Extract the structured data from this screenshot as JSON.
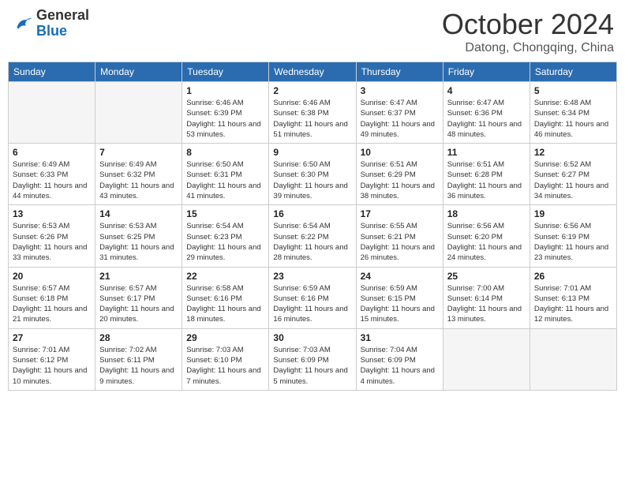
{
  "header": {
    "logo_general": "General",
    "logo_blue": "Blue",
    "month_title": "October 2024",
    "location": "Datong, Chongqing, China"
  },
  "days_of_week": [
    "Sunday",
    "Monday",
    "Tuesday",
    "Wednesday",
    "Thursday",
    "Friday",
    "Saturday"
  ],
  "weeks": [
    [
      {
        "day": "",
        "empty": true
      },
      {
        "day": "",
        "empty": true
      },
      {
        "day": "1",
        "sunrise": "Sunrise: 6:46 AM",
        "sunset": "Sunset: 6:39 PM",
        "daylight": "Daylight: 11 hours and 53 minutes."
      },
      {
        "day": "2",
        "sunrise": "Sunrise: 6:46 AM",
        "sunset": "Sunset: 6:38 PM",
        "daylight": "Daylight: 11 hours and 51 minutes."
      },
      {
        "day": "3",
        "sunrise": "Sunrise: 6:47 AM",
        "sunset": "Sunset: 6:37 PM",
        "daylight": "Daylight: 11 hours and 49 minutes."
      },
      {
        "day": "4",
        "sunrise": "Sunrise: 6:47 AM",
        "sunset": "Sunset: 6:36 PM",
        "daylight": "Daylight: 11 hours and 48 minutes."
      },
      {
        "day": "5",
        "sunrise": "Sunrise: 6:48 AM",
        "sunset": "Sunset: 6:34 PM",
        "daylight": "Daylight: 11 hours and 46 minutes."
      }
    ],
    [
      {
        "day": "6",
        "sunrise": "Sunrise: 6:49 AM",
        "sunset": "Sunset: 6:33 PM",
        "daylight": "Daylight: 11 hours and 44 minutes."
      },
      {
        "day": "7",
        "sunrise": "Sunrise: 6:49 AM",
        "sunset": "Sunset: 6:32 PM",
        "daylight": "Daylight: 11 hours and 43 minutes."
      },
      {
        "day": "8",
        "sunrise": "Sunrise: 6:50 AM",
        "sunset": "Sunset: 6:31 PM",
        "daylight": "Daylight: 11 hours and 41 minutes."
      },
      {
        "day": "9",
        "sunrise": "Sunrise: 6:50 AM",
        "sunset": "Sunset: 6:30 PM",
        "daylight": "Daylight: 11 hours and 39 minutes."
      },
      {
        "day": "10",
        "sunrise": "Sunrise: 6:51 AM",
        "sunset": "Sunset: 6:29 PM",
        "daylight": "Daylight: 11 hours and 38 minutes."
      },
      {
        "day": "11",
        "sunrise": "Sunrise: 6:51 AM",
        "sunset": "Sunset: 6:28 PM",
        "daylight": "Daylight: 11 hours and 36 minutes."
      },
      {
        "day": "12",
        "sunrise": "Sunrise: 6:52 AM",
        "sunset": "Sunset: 6:27 PM",
        "daylight": "Daylight: 11 hours and 34 minutes."
      }
    ],
    [
      {
        "day": "13",
        "sunrise": "Sunrise: 6:53 AM",
        "sunset": "Sunset: 6:26 PM",
        "daylight": "Daylight: 11 hours and 33 minutes."
      },
      {
        "day": "14",
        "sunrise": "Sunrise: 6:53 AM",
        "sunset": "Sunset: 6:25 PM",
        "daylight": "Daylight: 11 hours and 31 minutes."
      },
      {
        "day": "15",
        "sunrise": "Sunrise: 6:54 AM",
        "sunset": "Sunset: 6:23 PM",
        "daylight": "Daylight: 11 hours and 29 minutes."
      },
      {
        "day": "16",
        "sunrise": "Sunrise: 6:54 AM",
        "sunset": "Sunset: 6:22 PM",
        "daylight": "Daylight: 11 hours and 28 minutes."
      },
      {
        "day": "17",
        "sunrise": "Sunrise: 6:55 AM",
        "sunset": "Sunset: 6:21 PM",
        "daylight": "Daylight: 11 hours and 26 minutes."
      },
      {
        "day": "18",
        "sunrise": "Sunrise: 6:56 AM",
        "sunset": "Sunset: 6:20 PM",
        "daylight": "Daylight: 11 hours and 24 minutes."
      },
      {
        "day": "19",
        "sunrise": "Sunrise: 6:56 AM",
        "sunset": "Sunset: 6:19 PM",
        "daylight": "Daylight: 11 hours and 23 minutes."
      }
    ],
    [
      {
        "day": "20",
        "sunrise": "Sunrise: 6:57 AM",
        "sunset": "Sunset: 6:18 PM",
        "daylight": "Daylight: 11 hours and 21 minutes."
      },
      {
        "day": "21",
        "sunrise": "Sunrise: 6:57 AM",
        "sunset": "Sunset: 6:17 PM",
        "daylight": "Daylight: 11 hours and 20 minutes."
      },
      {
        "day": "22",
        "sunrise": "Sunrise: 6:58 AM",
        "sunset": "Sunset: 6:16 PM",
        "daylight": "Daylight: 11 hours and 18 minutes."
      },
      {
        "day": "23",
        "sunrise": "Sunrise: 6:59 AM",
        "sunset": "Sunset: 6:16 PM",
        "daylight": "Daylight: 11 hours and 16 minutes."
      },
      {
        "day": "24",
        "sunrise": "Sunrise: 6:59 AM",
        "sunset": "Sunset: 6:15 PM",
        "daylight": "Daylight: 11 hours and 15 minutes."
      },
      {
        "day": "25",
        "sunrise": "Sunrise: 7:00 AM",
        "sunset": "Sunset: 6:14 PM",
        "daylight": "Daylight: 11 hours and 13 minutes."
      },
      {
        "day": "26",
        "sunrise": "Sunrise: 7:01 AM",
        "sunset": "Sunset: 6:13 PM",
        "daylight": "Daylight: 11 hours and 12 minutes."
      }
    ],
    [
      {
        "day": "27",
        "sunrise": "Sunrise: 7:01 AM",
        "sunset": "Sunset: 6:12 PM",
        "daylight": "Daylight: 11 hours and 10 minutes."
      },
      {
        "day": "28",
        "sunrise": "Sunrise: 7:02 AM",
        "sunset": "Sunset: 6:11 PM",
        "daylight": "Daylight: 11 hours and 9 minutes."
      },
      {
        "day": "29",
        "sunrise": "Sunrise: 7:03 AM",
        "sunset": "Sunset: 6:10 PM",
        "daylight": "Daylight: 11 hours and 7 minutes."
      },
      {
        "day": "30",
        "sunrise": "Sunrise: 7:03 AM",
        "sunset": "Sunset: 6:09 PM",
        "daylight": "Daylight: 11 hours and 5 minutes."
      },
      {
        "day": "31",
        "sunrise": "Sunrise: 7:04 AM",
        "sunset": "Sunset: 6:09 PM",
        "daylight": "Daylight: 11 hours and 4 minutes."
      },
      {
        "day": "",
        "empty": true
      },
      {
        "day": "",
        "empty": true
      }
    ]
  ]
}
